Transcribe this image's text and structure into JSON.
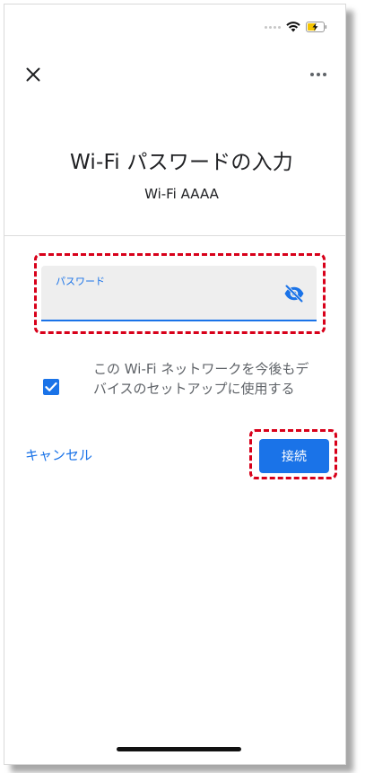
{
  "status_bar": {
    "icons": [
      "signal-dots-icon",
      "wifi-icon",
      "battery-charging-icon"
    ]
  },
  "app_bar": {
    "close_icon": "close-icon",
    "more_icon": "more-horizontal-icon"
  },
  "dialog": {
    "title": "Wi-Fi パスワードの入力",
    "ssid": "Wi-Fi  AAAA"
  },
  "password_field": {
    "label": "パスワード",
    "value": "",
    "toggle_icon": "eye-off-icon"
  },
  "checkbox": {
    "checked": true,
    "label": "この Wi-Fi ネットワークを今後もデバイスのセットアップに使用する"
  },
  "buttons": {
    "cancel_label": "キャンセル",
    "connect_label": "接続"
  },
  "colors": {
    "accent": "#1a73e8",
    "highlight": "#d8001a",
    "field_bg": "#eeeeee",
    "secondary_text": "#5f6368"
  }
}
